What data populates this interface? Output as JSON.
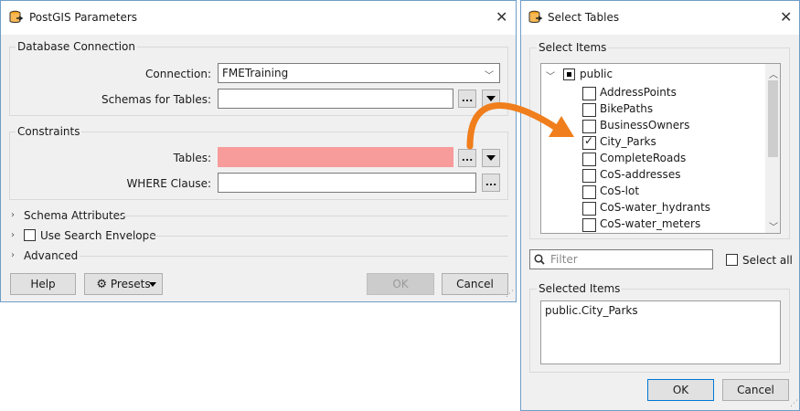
{
  "postgis": {
    "title": "PostGIS Parameters",
    "db_group_label": "Database Connection",
    "connection_label": "Connection:",
    "connection_value": "FMETraining",
    "schemas_label": "Schemas for Tables:",
    "schemas_value": "",
    "constraints_group_label": "Constraints",
    "tables_label": "Tables:",
    "tables_value": "",
    "where_label": "WHERE Clause:",
    "where_value": "",
    "browse_label": "...",
    "schema_attributes_label": "Schema Attributes",
    "search_envelope_label": "Use Search Envelope",
    "advanced_label": "Advanced",
    "help_label": "Help",
    "presets_label": "Presets",
    "ok_label": "OK",
    "cancel_label": "Cancel",
    "tables_field_color": "#f79b9b"
  },
  "select_tables": {
    "title": "Select Tables",
    "select_items_label": "Select Items",
    "root_node": "public",
    "items": [
      {
        "label": "AddressPoints",
        "checked": false
      },
      {
        "label": "BikePaths",
        "checked": false
      },
      {
        "label": "BusinessOwners",
        "checked": false
      },
      {
        "label": "City_Parks",
        "checked": true
      },
      {
        "label": "CompleteRoads",
        "checked": false
      },
      {
        "label": "CoS-addresses",
        "checked": false
      },
      {
        "label": "CoS-lot",
        "checked": false
      },
      {
        "label": "CoS-water_hydrants",
        "checked": false
      },
      {
        "label": "CoS-water_meters",
        "checked": false
      }
    ],
    "filter_placeholder": "Filter",
    "select_all_label": "Select all",
    "selected_items_label": "Selected Items",
    "selected_value": "public.City_Parks",
    "ok_label": "OK",
    "cancel_label": "Cancel"
  },
  "colors": {
    "annotation_arrow": "#f07e1c",
    "window_border": "#6f9ec9",
    "icon_orange": "#f39c12"
  }
}
